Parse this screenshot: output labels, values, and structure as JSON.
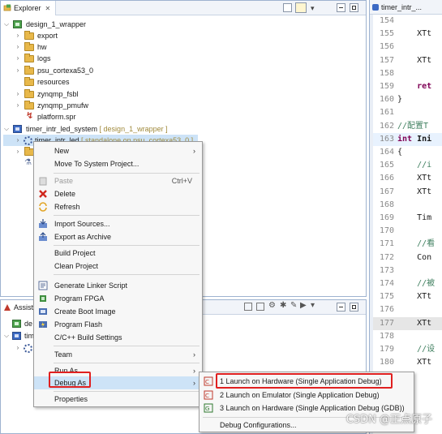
{
  "explorer": {
    "tab_label": "Explorer",
    "tree": [
      {
        "label": "design_1_wrapper",
        "level": 0,
        "icon": "project-icon",
        "expanded": true
      },
      {
        "label": "export",
        "level": 1,
        "icon": "folder-icon"
      },
      {
        "label": "hw",
        "level": 1,
        "icon": "folder-icon"
      },
      {
        "label": "logs",
        "level": 1,
        "icon": "folder-icon"
      },
      {
        "label": "psu_cortexa53_0",
        "level": 1,
        "icon": "folder-icon"
      },
      {
        "label": "resources",
        "level": 1,
        "icon": "folder-icon"
      },
      {
        "label": "zynqmp_fsbl",
        "level": 1,
        "icon": "folder-icon"
      },
      {
        "label": "zynqmp_pmufw",
        "level": 1,
        "icon": "folder-icon"
      },
      {
        "label": "platform.spr",
        "level": 1,
        "icon": "spr-file-icon"
      },
      {
        "label": "timer_intr_led_system",
        "suffix": "[ design_1_wrapper ]",
        "level": 0,
        "icon": "system-project-icon",
        "expanded": true
      },
      {
        "label": "timer_intr_led",
        "suffix": "[ standalone on psu_cortexa53_0 ]",
        "level": 1,
        "icon": "application-gear-icon",
        "selected": true
      }
    ]
  },
  "assistant": {
    "tab_label": "Assist",
    "rows": [
      {
        "label": "de"
      },
      {
        "label": "tim"
      }
    ]
  },
  "editor": {
    "tab_label": "timer_intr_...",
    "lines": [
      {
        "n": "154",
        "text": ""
      },
      {
        "n": "155",
        "text": "    XTt"
      },
      {
        "n": "156",
        "text": ""
      },
      {
        "n": "157",
        "text": "    XTt"
      },
      {
        "n": "158",
        "text": ""
      },
      {
        "n": "159",
        "text": "    ret",
        "kw": true
      },
      {
        "n": "160",
        "text": "}"
      },
      {
        "n": "161",
        "text": ""
      },
      {
        "n": "162",
        "text": "//配置T",
        "comment": true
      },
      {
        "n": "163",
        "text": "int Ini",
        "kw_prefix": "int",
        "rest": " Ini",
        "current": true
      },
      {
        "n": "164",
        "text": "{"
      },
      {
        "n": "165",
        "text": "    //i",
        "comment": true
      },
      {
        "n": "166",
        "text": "    XTt"
      },
      {
        "n": "167",
        "text": "    XTt"
      },
      {
        "n": "168",
        "text": ""
      },
      {
        "n": "169",
        "text": "    Tim"
      },
      {
        "n": "170",
        "text": ""
      },
      {
        "n": "171",
        "text": "    //看",
        "comment": true
      },
      {
        "n": "172",
        "text": "    Con"
      },
      {
        "n": "173",
        "text": ""
      },
      {
        "n": "174",
        "text": "    //被",
        "comment": true
      },
      {
        "n": "175",
        "text": "    XTt"
      },
      {
        "n": "176",
        "text": ""
      },
      {
        "n": "177",
        "text": "    XTt",
        "highlighted": true
      },
      {
        "n": "178",
        "text": ""
      },
      {
        "n": "179",
        "text": "    //设",
        "comment": true
      },
      {
        "n": "180",
        "text": "    XTt"
      },
      {
        "n": "181",
        "text": ""
      }
    ]
  },
  "context_menu": {
    "new": "New",
    "move_to_system": "Move To System Project...",
    "paste": "Paste",
    "paste_shortcut": "Ctrl+V",
    "delete": "Delete",
    "refresh": "Refresh",
    "import_sources": "Import Sources...",
    "export_archive": "Export as Archive",
    "build_project": "Build Project",
    "clean_project": "Clean Project",
    "gen_linker": "Generate Linker Script",
    "program_fpga": "Program FPGA",
    "create_boot_image": "Create Boot Image",
    "program_flash": "Program Flash",
    "cpp_build_settings": "C/C++ Build Settings",
    "team": "Team",
    "run_as": "Run As",
    "debug_as": "Debug As",
    "properties": "Properties"
  },
  "debug_submenu": {
    "item1": "1 Launch on Hardware (Single Application Debug)",
    "item2": "2 Launch on Emulator (Single Application Debug)",
    "item3": "3 Launch on Hardware (Single Application Debug (GDB))",
    "configs": "Debug Configurations..."
  },
  "watermark": "CSDN @正点原子",
  "colors": {
    "highlight_box": "#e02020",
    "selection": "#cde3f7",
    "keyword": "#7f0055",
    "comment": "#3f7f5f"
  }
}
